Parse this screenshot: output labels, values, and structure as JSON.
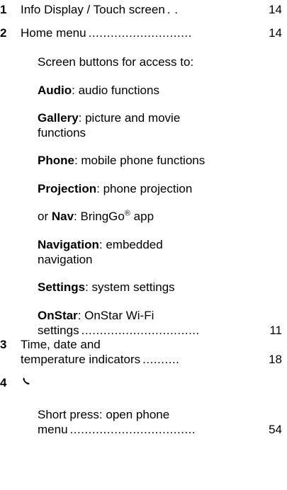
{
  "items": [
    {
      "number": "1",
      "label": "Info Display / Touch screen",
      "dots": " . .",
      "page": "14"
    },
    {
      "number": "2",
      "label": "Home menu",
      "dots": "............................",
      "page": "14"
    }
  ],
  "home_menu": {
    "intro": "Screen buttons for access to:",
    "buttons": [
      {
        "name": "Audio",
        "desc": ": audio functions"
      },
      {
        "name": "Gallery",
        "desc": ": picture and movie"
      },
      {
        "name": "Phone",
        "desc": ": mobile phone functions"
      },
      {
        "name": "Projection",
        "desc": ": phone projection"
      },
      {
        "name": "Navigation",
        "desc": ": embedded"
      },
      {
        "name": "Settings",
        "desc": ": system settings"
      },
      {
        "name": "OnStar",
        "desc": ": OnStar Wi-Fi"
      }
    ],
    "gallery_line2": "functions",
    "nav_prefix": "or ",
    "nav_name": "Nav",
    "nav_desc": ": BringGo",
    "nav_sup": "®",
    "nav_suffix": " app",
    "navigation_line2": "navigation",
    "onstar_line2": "settings",
    "onstar_dots": "................................",
    "onstar_page": "11"
  },
  "item3": {
    "number": "3",
    "line1": "Time, date and",
    "line2": "temperature indicators",
    "dots": "..........",
    "page": "18"
  },
  "item4": {
    "number": "4",
    "icon": "phone-icon",
    "line1": "Short press: open phone",
    "line2": "menu",
    "dots": "..................................",
    "page": "54"
  }
}
